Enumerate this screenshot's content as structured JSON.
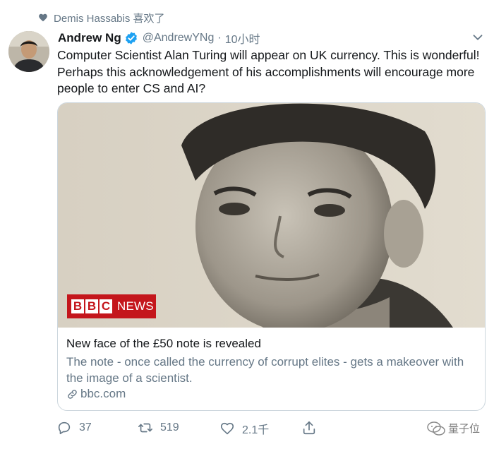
{
  "liked_by": {
    "text": "Demis Hassabis 喜欢了"
  },
  "tweet": {
    "author_name": "Andrew Ng",
    "handle": "@AndrewYNg",
    "separator": "·",
    "time": "10小时",
    "text": "Computer Scientist Alan Turing will appear on UK currency. This is wonderful! Perhaps this acknowledgement of his accomplishments will encourage more people to enter CS and AI?"
  },
  "card": {
    "logo_letters": [
      "B",
      "B",
      "C"
    ],
    "logo_word": "NEWS",
    "title": "New face of the £50 note is revealed",
    "description": "The note - once called the currency of corrupt elites - gets a makeover with the image of a scientist.",
    "domain": "bbc.com"
  },
  "actions": {
    "replies": "37",
    "retweets": "519",
    "likes": "2.1千"
  },
  "watermark": {
    "text": "量子位"
  },
  "colors": {
    "secondary_text": "#657786",
    "verified_blue": "#1da1f2",
    "bbc_red": "#c4161c",
    "card_border": "#ccd6dd"
  },
  "icons": {
    "liked": "heart-icon",
    "verified": "verified-badge-icon",
    "more": "chevron-down-icon",
    "link": "link-icon",
    "reply": "reply-icon",
    "retweet": "retweet-icon",
    "like": "like-icon",
    "share": "share-icon",
    "watermark": "wechat-icon"
  }
}
